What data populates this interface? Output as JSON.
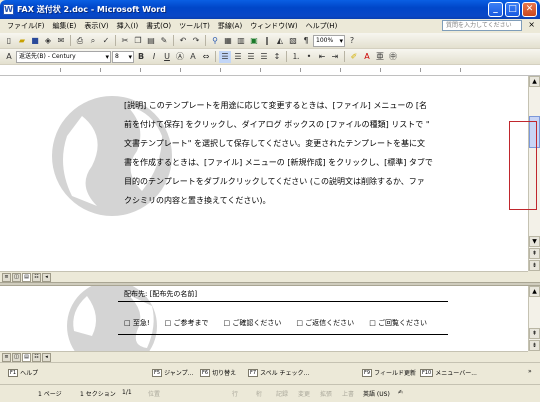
{
  "window": {
    "title": "FAX 送付状 2.doc - Microsoft Word",
    "app_icon_letter": "W",
    "minimize": "_",
    "maximize": "□",
    "close": "✕"
  },
  "menu": {
    "items": [
      "ファイル(F)",
      "編集(E)",
      "表示(V)",
      "挿入(I)",
      "書式(O)",
      "ツール(T)",
      "罫線(A)",
      "ウィンドウ(W)",
      "ヘルプ(H)"
    ],
    "help_placeholder": "質問を入力してください",
    "close": "×"
  },
  "toolbar": {
    "zoom": "100%",
    "style": "返送先(B) - Century",
    "font_size": "8",
    "bold": "B",
    "italic": "I",
    "underline": "U"
  },
  "document": {
    "body_lines": [
      "[説明] このテンプレートを用途に応じて変更するときは、[ファイル] メニューの [名",
      "前を付けて保存] をクリックし、ダイアログ ボックスの [ファイルの種類] リストで \"",
      "文書テンプレート\" を選択して保存してください。変更されたテンプレートを基に文",
      "書を作成するときは、[ファイル] メニューの [新規作成] をクリックし、[標準] タブで",
      "目的のテンプレートをダブルクリックしてください (この説明文は削除するか、ファ",
      "クシミリの内容と置き換えてください)。"
    ]
  },
  "lower": {
    "distribution": "配布先: [配布先の名前]",
    "checkboxes": [
      "□ 至急!",
      "□ ご参考まで",
      "□ ご確認ください",
      "□ ご返信ください",
      "□ ご回覧ください"
    ]
  },
  "fkeys": [
    {
      "key": "F1",
      "label": "ヘルプ",
      "dim": false
    },
    {
      "key": "F5",
      "label": "ジャンプ...",
      "dim": false
    },
    {
      "key": "F6",
      "label": "切り替え",
      "dim": false
    },
    {
      "key": "F7",
      "label": "スペル チェック...",
      "dim": false
    },
    {
      "key": "F9",
      "label": "フィールド更新",
      "dim": false
    },
    {
      "key": "F10",
      "label": "メニューバー...",
      "dim": false
    }
  ],
  "status": {
    "page": "1 ページ",
    "section": "1 セクション",
    "pages": "1/1",
    "position": "位置",
    "line": "行",
    "column": "桁",
    "rec": "記録",
    "trk": "変更",
    "ext": "拡張",
    "ovr": "上書",
    "language": "英語 (US)"
  }
}
